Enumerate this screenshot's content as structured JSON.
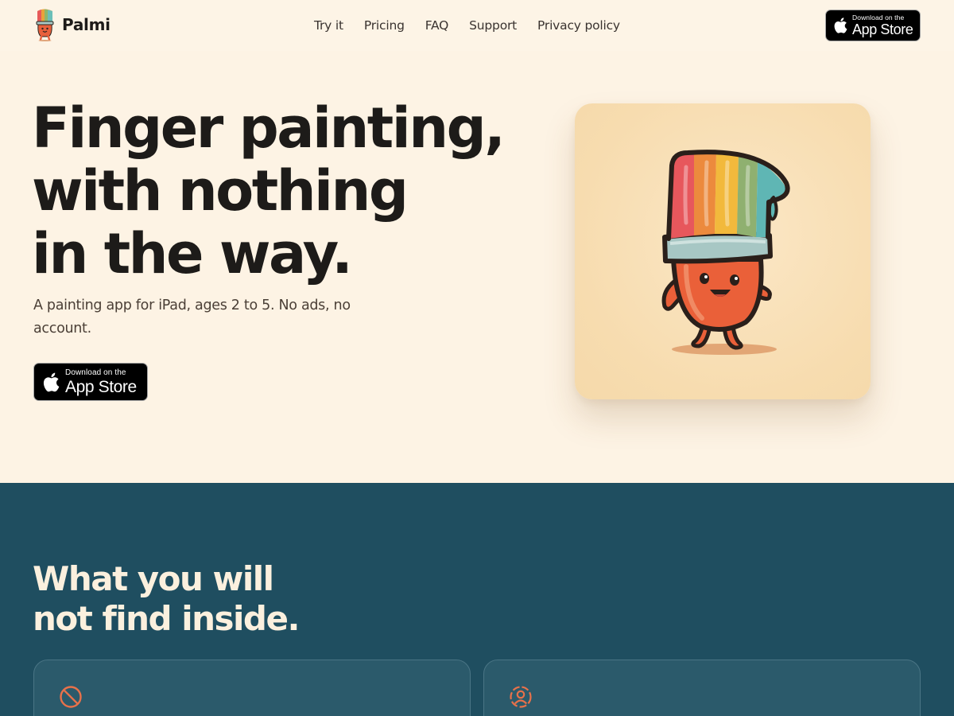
{
  "brand": {
    "name": "Palmi"
  },
  "nav": {
    "items": [
      {
        "label": "Try it"
      },
      {
        "label": "Pricing"
      },
      {
        "label": "FAQ"
      },
      {
        "label": "Support"
      },
      {
        "label": "Privacy policy"
      }
    ]
  },
  "app_store_badge": {
    "small": "Download on the",
    "big": "App Store"
  },
  "hero": {
    "title_lines": [
      "Finger painting,",
      "with nothing",
      "in the way."
    ],
    "subtitle": "A painting app for iPad, ages 2 to 5. No ads, no account."
  },
  "features": {
    "title_lines": [
      "What you will",
      "not find inside."
    ],
    "cards": [
      {
        "icon": "no-entry-icon"
      },
      {
        "icon": "user-account-icon"
      }
    ]
  },
  "colors": {
    "background": "#fdf3e4",
    "dark_section": "#1f4e60",
    "card": "#2b5a6b",
    "accent": "#e8714a",
    "text": "#1d1b19"
  }
}
